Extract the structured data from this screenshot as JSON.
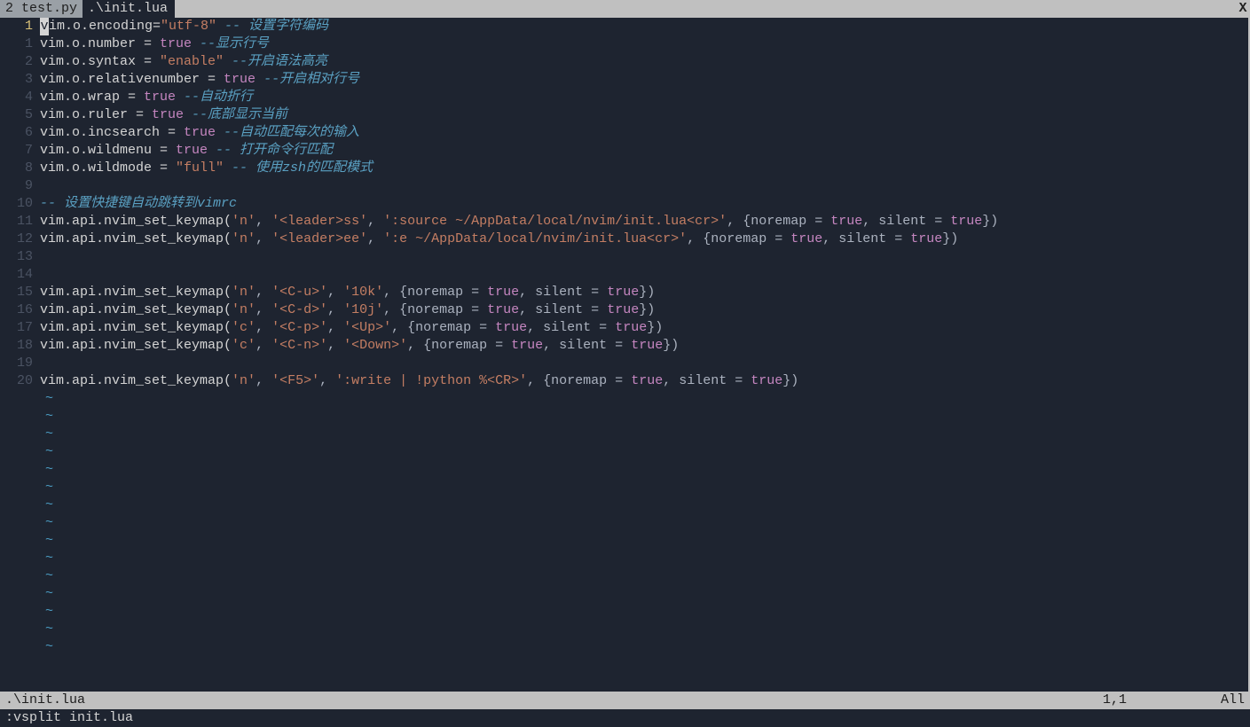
{
  "tabs": {
    "inactive": " 2 test.py ",
    "active": " .\\init.lua ",
    "close": "X"
  },
  "gutter": {
    "current": "1",
    "rel": [
      "1",
      "2",
      "3",
      "4",
      "5",
      "6",
      "7",
      "8",
      "9",
      "10",
      "11",
      "12",
      "13",
      "14",
      "15",
      "16",
      "17",
      "18",
      "19",
      "20"
    ]
  },
  "tildes_count": 15,
  "code": {
    "l0": {
      "cursor": "v",
      "a": "im.o.encoding=",
      "s": "\"utf-8\"",
      "c": " -- 设置字符编码"
    },
    "l1": {
      "a": "vim.o.number = ",
      "b": "true",
      "c": " --显示行号"
    },
    "l2": {
      "a": "vim.o.syntax = ",
      "s": "\"enable\"",
      "c": " --开启语法高亮"
    },
    "l3": {
      "a": "vim.o.relativenumber = ",
      "b": "true",
      "c": " --开启相对行号"
    },
    "l4": {
      "a": "vim.o.wrap = ",
      "b": "true",
      "c": " --自动折行"
    },
    "l5": {
      "a": "vim.o.ruler = ",
      "b": "true",
      "c": " --底部显示当前"
    },
    "l6": {
      "a": "vim.o.incsearch = ",
      "b": "true",
      "c": " --自动匹配每次的输入"
    },
    "l7": {
      "a": "vim.o.wildmenu = ",
      "b": "true",
      "c": " -- 打开命令行匹配"
    },
    "l8": {
      "a": "vim.o.wildmode = ",
      "s": "\"full\"",
      "c": " -- 使用zsh的匹配模式"
    },
    "l9": {
      "a": ""
    },
    "l10": {
      "c": "-- 设置快捷键自动跳转到vimrc"
    },
    "l11": {
      "a": "vim.api.nvim_set_keymap(",
      "s1": "'n'",
      "p1": ", ",
      "s2": "'<leader>ss'",
      "p2": ", ",
      "s3": "':source ~/AppData/local/nvim/init.lua<cr>'",
      "p3": ", {noremap = ",
      "b1": "true",
      "p4": ", silent = ",
      "b2": "true",
      "p5": "})"
    },
    "l12": {
      "a": "vim.api.nvim_set_keymap(",
      "s1": "'n'",
      "p1": ", ",
      "s2": "'<leader>ee'",
      "p2": ", ",
      "s3": "':e ~/AppData/local/nvim/init.lua<cr>'",
      "p3": ", {noremap = ",
      "b1": "true",
      "p4": ", silent = ",
      "b2": "true",
      "p5": "})"
    },
    "l13": {
      "a": ""
    },
    "l14": {
      "a": ""
    },
    "l15": {
      "a": "vim.api.nvim_set_keymap(",
      "s1": "'n'",
      "p1": ", ",
      "s2": "'<C-u>'",
      "p2": ", ",
      "s3": "'10k'",
      "p3": ", {noremap = ",
      "b1": "true",
      "p4": ", silent = ",
      "b2": "true",
      "p5": "})"
    },
    "l16": {
      "a": "vim.api.nvim_set_keymap(",
      "s1": "'n'",
      "p1": ", ",
      "s2": "'<C-d>'",
      "p2": ", ",
      "s3": "'10j'",
      "p3": ", {noremap = ",
      "b1": "true",
      "p4": ", silent = ",
      "b2": "true",
      "p5": "})"
    },
    "l17": {
      "a": "vim.api.nvim_set_keymap(",
      "s1": "'c'",
      "p1": ", ",
      "s2": "'<C-p>'",
      "p2": ", ",
      "s3": "'<Up>'",
      "p3": ", {noremap = ",
      "b1": "true",
      "p4": ", silent = ",
      "b2": "true",
      "p5": "})"
    },
    "l18": {
      "a": "vim.api.nvim_set_keymap(",
      "s1": "'c'",
      "p1": ", ",
      "s2": "'<C-n>'",
      "p2": ", ",
      "s3": "'<Down>'",
      "p3": ", {noremap = ",
      "b1": "true",
      "p4": ", silent = ",
      "b2": "true",
      "p5": "})"
    },
    "l19": {
      "a": ""
    },
    "l20": {
      "a": "vim.api.nvim_set_keymap(",
      "s1": "'n'",
      "p1": ", ",
      "s2": "'<F5>'",
      "p2": ", ",
      "s3": "':write | !python %<CR>'",
      "p3": ", {noremap = ",
      "b1": "true",
      "p4": ", silent = ",
      "b2": "true",
      "p5": "})"
    }
  },
  "status": {
    "name": ".\\init.lua",
    "pos": "1,1",
    "pct": "All"
  },
  "cmdline": ":vsplit init.lua"
}
